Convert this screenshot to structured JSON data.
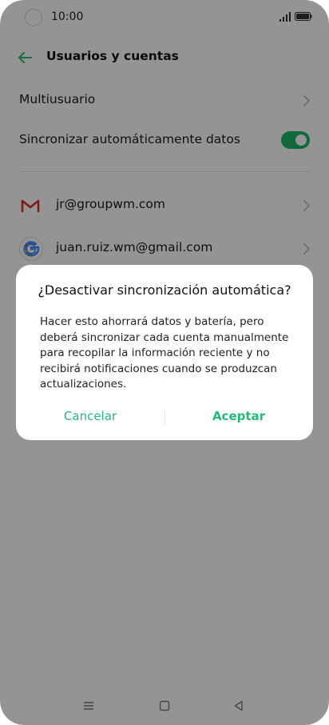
{
  "status_bar": {
    "time": "10:00"
  },
  "header": {
    "title": "Usuarios y cuentas",
    "back_icon": "arrow-left-icon"
  },
  "settings": {
    "multiuser_label": "Multiusuario",
    "auto_sync_label": "Sincronizar automáticamente datos",
    "auto_sync_enabled": true
  },
  "accounts": [
    {
      "label": "jr@groupwm.com",
      "icon": "gmail-icon"
    },
    {
      "label": "juan.ruiz.wm@gmail.com",
      "icon": "google-icon"
    }
  ],
  "dialog": {
    "title": "¿Desactivar sincronización automática?",
    "body": "Hacer esto ahorrará datos y batería, pero deberá sincronizar cada cuenta manualmente para recopilar la información reciente y no recibirá notificaciones cuando se produzcan actualizaciones.",
    "cancel_label": "Cancelar",
    "accept_label": "Aceptar"
  },
  "colors": {
    "accent": "#25b879",
    "toggle_on": "#1db36a",
    "scrim": "rgba(0,0,0,0.42)"
  },
  "nav_bar": {
    "icons": [
      "menu-icon",
      "home-icon",
      "back-triangle-icon"
    ]
  }
}
